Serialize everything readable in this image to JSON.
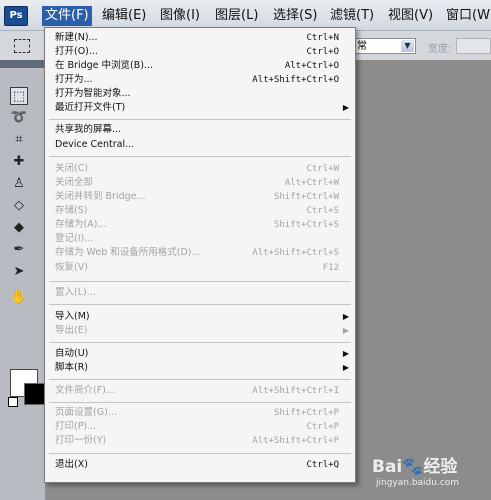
{
  "app": {
    "logo": "Ps"
  },
  "menubar": [
    {
      "label": "文件(F)",
      "active": true
    },
    {
      "label": "编辑(E)"
    },
    {
      "label": "图像(I)"
    },
    {
      "label": "图层(L)"
    },
    {
      "label": "选择(S)"
    },
    {
      "label": "滤镜(T)"
    },
    {
      "label": "视图(V)"
    },
    {
      "label": "窗口(W)"
    }
  ],
  "options_bar": {
    "style_value": "常",
    "width_label": "宽度:"
  },
  "file_menu": {
    "items": [
      {
        "label": "新建(N)...",
        "shortcut": "Ctrl+N",
        "enabled": true
      },
      {
        "label": "打开(O)...",
        "shortcut": "Ctrl+O",
        "enabled": true
      },
      {
        "label": "在 Bridge 中浏览(B)...",
        "shortcut": "Alt+Ctrl+O",
        "enabled": true
      },
      {
        "label": "打开为...",
        "shortcut": "Alt+Shift+Ctrl+O",
        "enabled": true
      },
      {
        "label": "打开为智能对象...",
        "shortcut": "",
        "enabled": true
      },
      {
        "label": "最近打开文件(T)",
        "shortcut": "",
        "enabled": true,
        "submenu": true
      },
      {
        "label": "共享我的屏幕...",
        "shortcut": "",
        "enabled": true
      },
      {
        "label": "Device Central...",
        "shortcut": "",
        "enabled": true
      },
      {
        "label": "关闭(C)",
        "shortcut": "Ctrl+W",
        "enabled": false
      },
      {
        "label": "关闭全部",
        "shortcut": "Alt+Ctrl+W",
        "enabled": false
      },
      {
        "label": "关闭并转到 Bridge...",
        "shortcut": "Shift+Ctrl+W",
        "enabled": false
      },
      {
        "label": "存储(S)",
        "shortcut": "Ctrl+S",
        "enabled": false
      },
      {
        "label": "存储为(A)...",
        "shortcut": "Shift+Ctrl+S",
        "enabled": false
      },
      {
        "label": "登记(I)...",
        "shortcut": "",
        "enabled": false
      },
      {
        "label": "存储为 Web 和设备所用格式(D)...",
        "shortcut": "Alt+Shift+Ctrl+S",
        "enabled": false
      },
      {
        "label": "恢复(V)",
        "shortcut": "F12",
        "enabled": false
      },
      {
        "label": "置入(L)...",
        "shortcut": "",
        "enabled": false
      },
      {
        "label": "导入(M)",
        "shortcut": "",
        "enabled": true,
        "submenu": true
      },
      {
        "label": "导出(E)",
        "shortcut": "",
        "enabled": false,
        "submenu": true
      },
      {
        "label": "自动(U)",
        "shortcut": "",
        "enabled": true,
        "submenu": true
      },
      {
        "label": "脚本(R)",
        "shortcut": "",
        "enabled": true,
        "submenu": true
      },
      {
        "label": "文件简介(F)...",
        "shortcut": "Alt+Shift+Ctrl+I",
        "enabled": false
      },
      {
        "label": "页面设置(G)...",
        "shortcut": "Shift+Ctrl+P",
        "enabled": false
      },
      {
        "label": "打印(P)...",
        "shortcut": "Ctrl+P",
        "enabled": false
      },
      {
        "label": "打印一份(Y)",
        "shortcut": "Alt+Shift+Ctrl+P",
        "enabled": false
      },
      {
        "label": "退出(X)",
        "shortcut": "Ctrl+Q",
        "enabled": true
      }
    ]
  },
  "watermark": {
    "logo": "Bai🐾经验",
    "url": "jingyan.baidu.com"
  }
}
